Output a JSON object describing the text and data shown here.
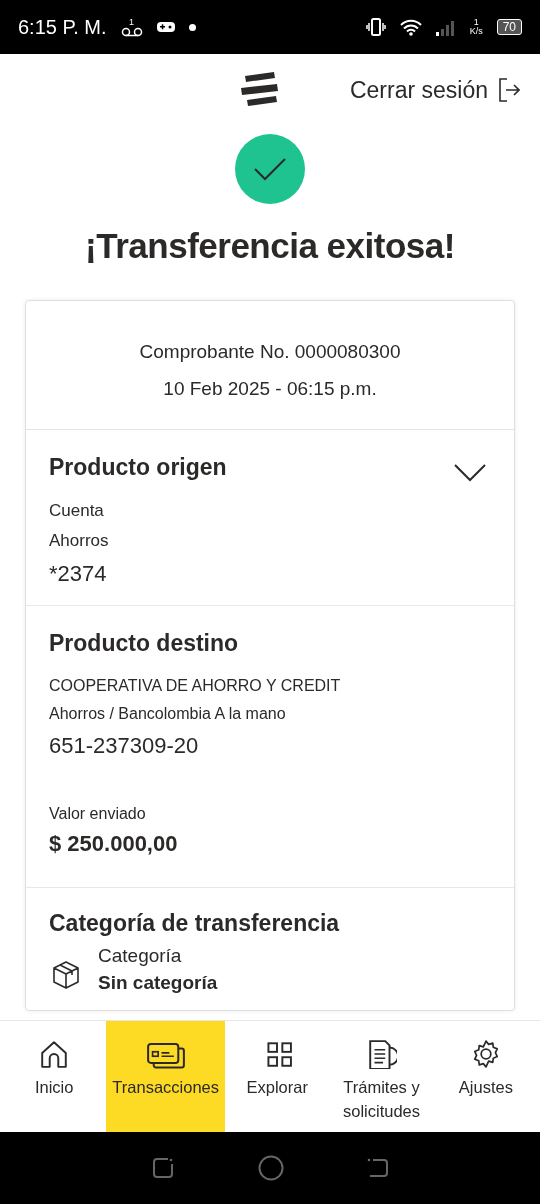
{
  "status_bar": {
    "time": "6:15 P. M.",
    "voicemail_count": "1",
    "network_speed": "1",
    "network_unit": "K/s",
    "battery": "70"
  },
  "header": {
    "logout": "Cerrar sesión"
  },
  "title": "¡Transferencia exitosa!",
  "receipt": {
    "number": "Comprobante No. 0000080300",
    "date": "10 Feb 2025 - 06:15 p.m."
  },
  "sections": [
    {
      "kind": "origin",
      "heading": "Producto origen",
      "lines": [
        "Cuenta",
        "Ahorros"
      ],
      "value": "*2374"
    },
    {
      "kind": "destination",
      "heading": "Producto destino",
      "lines": [
        "COOPERATIVA DE AHORRO Y CREDIT",
        "Ahorros / Bancolombia A la mano"
      ],
      "value": "651-237309-20",
      "amount_label": "Valor enviado",
      "amount": "$ 250.000,00"
    },
    {
      "kind": "category",
      "heading": "Categoría de transferencia",
      "label": "Categoría",
      "value": "Sin categoría"
    }
  ],
  "nav": [
    {
      "label": "Inicio",
      "kind": "home",
      "selected": false
    },
    {
      "label": "Transacciones",
      "kind": "cards",
      "selected": true
    },
    {
      "label": "Explorar",
      "kind": "grid",
      "selected": false
    },
    {
      "label": "Trámites y solicitudes",
      "kind": "document",
      "selected": false
    },
    {
      "label": "Ajustes",
      "kind": "settings",
      "selected": false
    }
  ]
}
